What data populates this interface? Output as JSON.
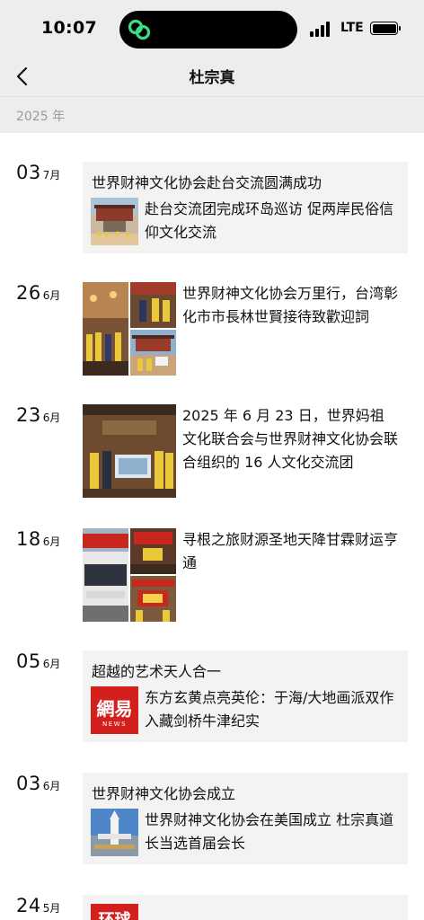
{
  "status_bar": {
    "time": "10:07",
    "network": "LTE"
  },
  "nav": {
    "title": "杜宗真"
  },
  "year_label": "2025 年",
  "posts": [
    {
      "day": "03",
      "month": "7月",
      "title": "世界财神文化协会赴台交流圆满成功",
      "desc": "赴台交流团完成环岛巡访 促两岸民俗信仰文化交流"
    },
    {
      "day": "26",
      "month": "6月",
      "text": "世界财神文化协会万里行，台湾彰化市市長林世賢接待致歡迎詞"
    },
    {
      "day": "23",
      "month": "6月",
      "text": "2025 年 6 月 23 日，世界妈祖文化联合会与世界财神文化协会联合组织的 16 人文化交流团"
    },
    {
      "day": "18",
      "month": "6月",
      "text": "寻根之旅财源圣地天降甘霖财运亨通"
    },
    {
      "day": "05",
      "month": "6月",
      "title": "超越的艺术天人合一",
      "desc": "东方玄黄点亮英伦：于海/大地画派双作入藏剑桥牛津纪实",
      "logo": "網易",
      "logo_sub": "NEWS"
    },
    {
      "day": "03",
      "month": "6月",
      "title": "世界财神文化协会成立",
      "desc": "世界财神文化协会在美国成立 杜宗真道长当选首届会长"
    },
    {
      "day": "24",
      "month": "5月",
      "logo": "环球"
    }
  ]
}
